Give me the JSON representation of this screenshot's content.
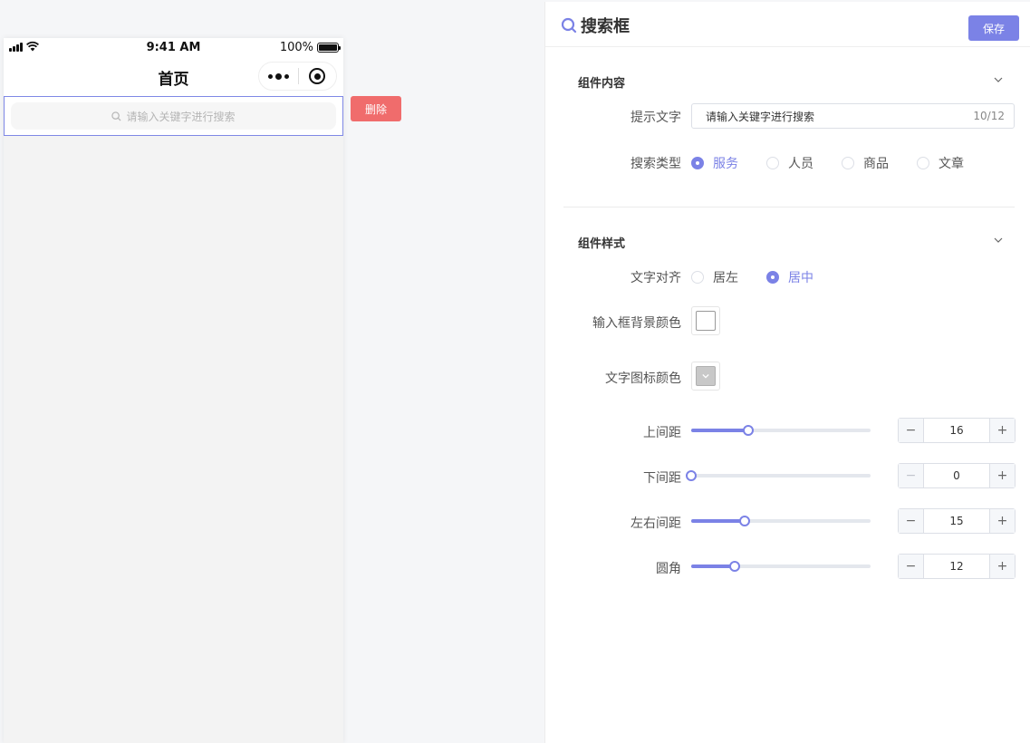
{
  "phone": {
    "time": "9:41 AM",
    "battery": "100%",
    "nav_title": "首页",
    "search_placeholder": "请输入关键字进行搜索"
  },
  "delete_label": "删除",
  "panel": {
    "title": "搜索框",
    "save_label": "保存",
    "content_section": {
      "title": "组件内容",
      "hint_label": "提示文字",
      "hint_value": "请输入关键字进行搜索",
      "hint_count": "10/12",
      "type_label": "搜索类型",
      "type_options": [
        "服务",
        "人员",
        "商品",
        "文章"
      ],
      "type_selected": "服务"
    },
    "style_section": {
      "title": "组件样式",
      "align_label": "文字对齐",
      "align_options": [
        "居左",
        "居中"
      ],
      "align_selected": "居中",
      "bg_color_label": "输入框背景颜色",
      "bg_color": "#ffffff",
      "icon_color_label": "文字图标颜色",
      "icon_color": "#c8c8c8",
      "sliders": [
        {
          "label": "上间距",
          "value": "16",
          "fraction": 0.32
        },
        {
          "label": "下间距",
          "value": "0",
          "fraction": 0.0
        },
        {
          "label": "左右间距",
          "value": "15",
          "fraction": 0.3
        },
        {
          "label": "圆角",
          "value": "12",
          "fraction": 0.24
        }
      ]
    }
  },
  "colors": {
    "accent": "#7b82e6",
    "danger": "#f06c6c"
  }
}
